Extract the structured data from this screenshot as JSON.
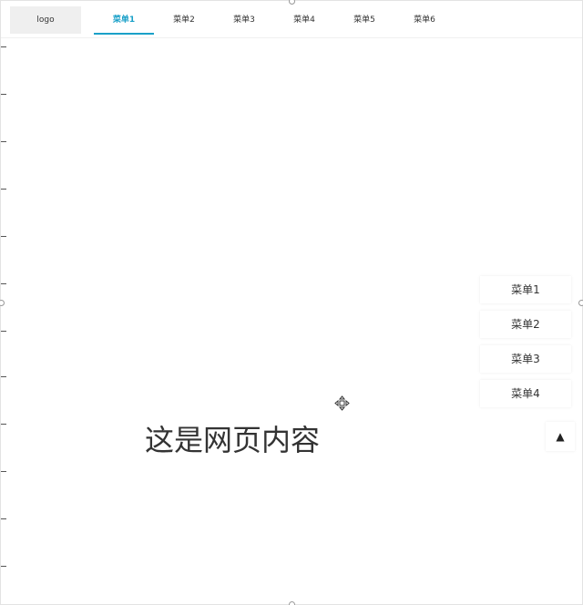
{
  "header": {
    "logo_text": "logo",
    "tabs": [
      {
        "label": "菜单1",
        "active": true
      },
      {
        "label": "菜单2",
        "active": false
      },
      {
        "label": "菜单3",
        "active": false
      },
      {
        "label": "菜单4",
        "active": false
      },
      {
        "label": "菜单5",
        "active": false
      },
      {
        "label": "菜单6",
        "active": false
      }
    ],
    "accent_color": "#1aa0c8"
  },
  "main": {
    "content_text": "这是网页内容",
    "cursor_icon": "move-icon"
  },
  "side_menu": {
    "items": [
      {
        "label": "菜单1"
      },
      {
        "label": "菜单2"
      },
      {
        "label": "菜单3"
      },
      {
        "label": "菜单4"
      }
    ],
    "back_to_top_symbol": "▲"
  }
}
